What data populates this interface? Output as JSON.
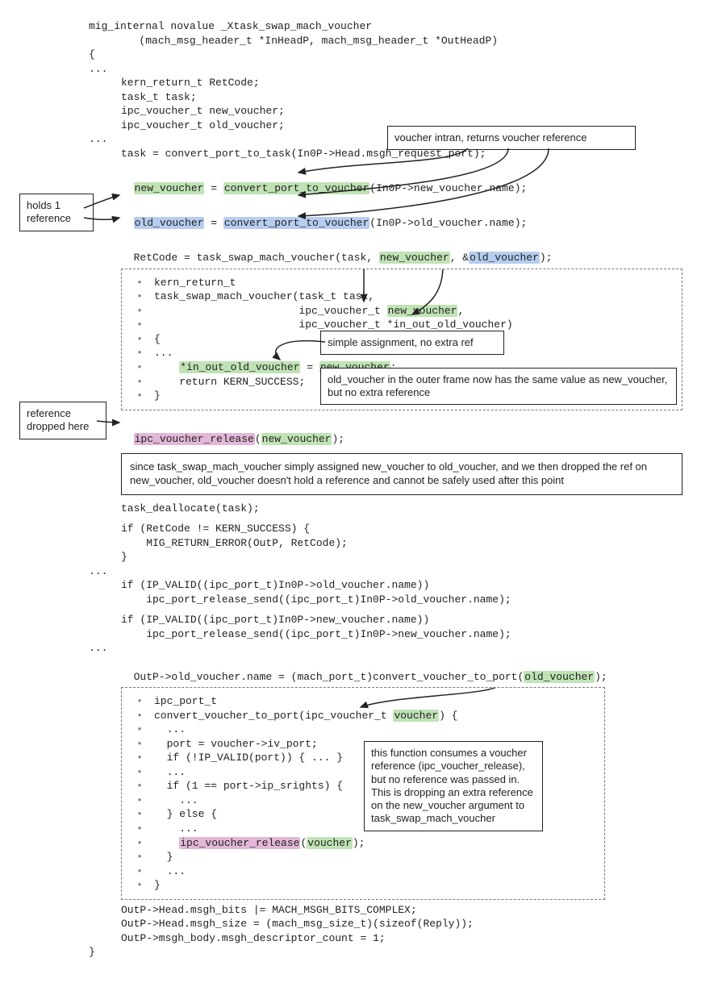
{
  "sig1": "mig_internal novalue _Xtask_swap_mach_voucher",
  "sig2": "        (mach_msg_header_t *InHeadP, mach_msg_header_t *OutHeadP)",
  "open_brace": "{",
  "dots": "...",
  "decl1": "kern_return_t RetCode;",
  "decl2": "task_t task;",
  "decl3": "ipc_voucher_t new_voucher;",
  "decl4": "ipc_voucher_t old_voucher;",
  "task_assign": "task = convert_port_to_task(In0P->Head.msgh_request_port);",
  "nv_lhs": "new_voucher",
  "eq": " = ",
  "nv_fn": "convert_port_to_voucher",
  "nv_rhs": "(In0P->new_voucher.name);",
  "ov_lhs": "old_voucher",
  "ov_fn": "convert_port_to_voucher",
  "ov_rhs": "(In0P->old_voucher.name);",
  "ret_pre": "RetCode = task_swap_mach_voucher(task, ",
  "ret_mid": ", &",
  "ret_end": ");",
  "inner1a": "kern_return_t",
  "inner1b": "task_swap_mach_voucher(task_t task,",
  "inner1c": "                       ipc_voucher_t ",
  "inner1c_hl": "new_voucher",
  "inner1c_end": ",",
  "inner1d": "                       ipc_voucher_t *in_out_old_voucher)",
  "inner_open": "{",
  "inner_dots": "...",
  "inner_assign_l": "*in_out_old_voucher",
  "inner_assign_eq": " = ",
  "inner_assign_r": "new_voucher",
  "inner_assign_end": ";",
  "inner_ret": "    return KERN_SUCCESS;",
  "inner_close": "}",
  "ipc_rel_fn": "ipc_voucher_release",
  "ipc_rel_arg": "new_voucher",
  "task_dealloc": "task_deallocate(task);",
  "if_ret": "if (RetCode != KERN_SUCCESS) {",
  "mig_err": "    MIG_RETURN_ERROR(OutP, RetCode);",
  "close_brace": "}",
  "if_old": "if (IP_VALID((ipc_port_t)In0P->old_voucher.name))",
  "rel_old": "    ipc_port_release_send((ipc_port_t)In0P->old_voucher.name);",
  "if_new": "if (IP_VALID((ipc_port_t)In0P->new_voucher.name))",
  "rel_new": "    ipc_port_release_send((ipc_port_t)In0P->new_voucher.name);",
  "outp_pre": "OutP->old_voucher.name = (mach_port_t)convert_voucher_to_port(",
  "outp_hl": "old_voucher",
  "outp_end": ");",
  "d2_a": "ipc_port_t",
  "d2_b_pre": "convert_voucher_to_port(ipc_voucher_t ",
  "d2_b_hl": "voucher",
  "d2_b_end": ") {",
  "d2_dots": "  ...",
  "d2_c": "  port = voucher->iv_port;",
  "d2_d": "  if (!IP_VALID(port)) { ... }",
  "d2_e": "  if (1 == port->ip_srights) {",
  "d2_e2": "    ...",
  "d2_f": "  } else {",
  "d2_f2": "    ...",
  "d2_rel_fn": "ipc_voucher_release",
  "d2_rel_arg": "voucher",
  "d2_g": "  }",
  "d2_h": "}",
  "tail1": "OutP->Head.msgh_bits |= MACH_MSGH_BITS_COMPLEX;",
  "tail2": "OutP->Head.msgh_size = (mach_msg_size_t)(sizeof(Reply));",
  "tail3": "OutP->msgh_body.msgh_descriptor_count = 1;",
  "end_brace": "}",
  "call_intran": "voucher intran, returns voucher reference",
  "call_holds": "holds 1\nreference",
  "call_simple": "simple assignment, no extra ref",
  "call_same": "old_voucher in the outer frame now has the same value as new_voucher, but no extra reference",
  "call_refdrop": "reference\ndropped here",
  "call_since": "since task_swap_mach_voucher simply assigned new_voucher to old_voucher, and we then dropped the ref on new_voucher, old_voucher doesn't hold a reference and cannot be safely used after this point",
  "call_consumes": "this function consumes a voucher reference (ipc_voucher_release), but no reference was passed in. This is dropping an extra reference on the new_voucher argument to task_swap_mach_voucher"
}
